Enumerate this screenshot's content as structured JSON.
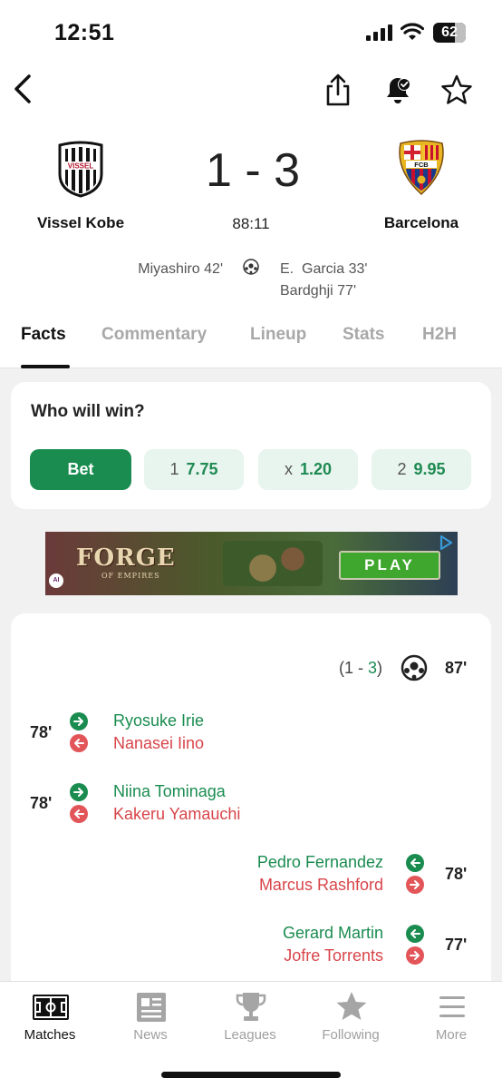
{
  "status_bar": {
    "time": "12:51",
    "battery": "62"
  },
  "match": {
    "home_team": "Vissel Kobe",
    "away_team": "Barcelona",
    "score": "1 - 3",
    "clock": "88:11",
    "home_scorers": [
      "Miyashiro 42'"
    ],
    "away_scorers": [
      "E.  Garcia 33'",
      "Bardghji 77'"
    ],
    "home_logo_text": "VISSEL",
    "away_logo_text": "FCB"
  },
  "tabs": [
    "Facts",
    "Commentary",
    "Lineup",
    "Stats",
    "H2H"
  ],
  "bet": {
    "title": "Who will win?",
    "bet_label": "Bet",
    "odds": [
      {
        "key": "1",
        "value": "7.75"
      },
      {
        "key": "x",
        "value": "1.20"
      },
      {
        "key": "2",
        "value": "9.95"
      }
    ]
  },
  "ad": {
    "title": "FORGE",
    "subtitle": "OF EMPIRES",
    "cta": "PLAY"
  },
  "events": {
    "goal": {
      "score_open": "(1 - ",
      "score_highlight": "3",
      "score_close": ")",
      "minute": "87'"
    },
    "substitutions": [
      {
        "minute": "78'",
        "player_in": "Ryosuke Irie",
        "player_out": "Nanasei Iino",
        "side": "home"
      },
      {
        "minute": "78'",
        "player_in": "Niina Tominaga",
        "player_out": "Kakeru Yamauchi",
        "side": "home"
      },
      {
        "minute": "78'",
        "player_in": "Pedro Fernandez",
        "player_out": "Marcus Rashford",
        "side": "away"
      },
      {
        "minute": "77'",
        "player_in": "Gerard Martin",
        "player_out": "Jofre Torrents",
        "side": "away"
      }
    ]
  },
  "bottom_nav": [
    {
      "label": "Matches",
      "icon": "pitch-icon",
      "active": true
    },
    {
      "label": "News",
      "icon": "news-icon",
      "active": false
    },
    {
      "label": "Leagues",
      "icon": "trophy-icon",
      "active": false
    },
    {
      "label": "Following",
      "icon": "star-icon",
      "active": false
    },
    {
      "label": "More",
      "icon": "menu-icon",
      "active": false
    }
  ],
  "colors": {
    "accent": "#1a8c50",
    "sub_out": "#d8454a",
    "background": "#f1f1f1"
  }
}
